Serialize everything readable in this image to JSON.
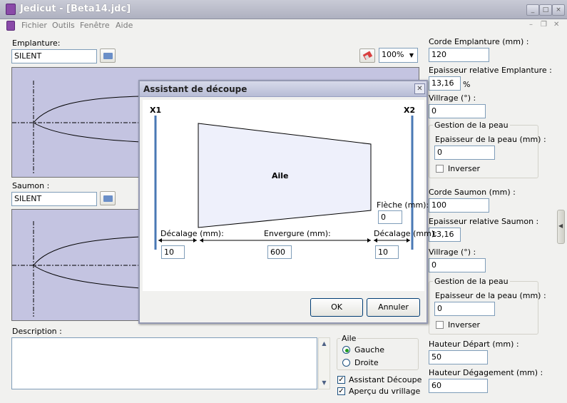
{
  "window": {
    "title": "Jedicut - [Beta14.jdc]"
  },
  "menu": {
    "items": [
      "Fichier",
      "Outils",
      "Fenêtre",
      "Aide"
    ]
  },
  "emplanture": {
    "label": "Emplanture:",
    "profile": "SILENT"
  },
  "zoom": {
    "value": "100%"
  },
  "saumon": {
    "label": "Saumon :",
    "profile": "SILENT"
  },
  "description": {
    "label": "Description :",
    "value": ""
  },
  "aile": {
    "label": "Aile",
    "options": [
      "Gauche",
      "Droite"
    ],
    "selected": "Gauche"
  },
  "checks": {
    "assistant": {
      "label": "Assistant Découpe",
      "checked": true
    },
    "apercu": {
      "label": "Aperçu du vrillage",
      "checked": true
    }
  },
  "right": {
    "corde_emp_label": "Corde Emplanture (mm) :",
    "corde_emp": "120",
    "epais_emp_label": "Epaisseur relative Emplanture :",
    "epais_emp": "13,16",
    "percent": "%",
    "vrillage1_label": "Villrage (°) :",
    "vrillage1": "0",
    "peau1_title": "Gestion de la peau",
    "peau1_label": "Epaisseur de la peau (mm) :",
    "peau1": "0",
    "inverser1": "Inverser",
    "corde_sau_label": "Corde Saumon (mm) :",
    "corde_sau": "100",
    "epais_sau_label": "Epaisseur relative Saumon :",
    "epais_sau": "13,16",
    "vrillage2_label": "Villrage (°) :",
    "vrillage2": "0",
    "peau2_title": "Gestion de la peau",
    "peau2_label": "Epaisseur de la peau (mm) :",
    "peau2": "0",
    "inverser2": "Inverser",
    "h_depart_label": "Hauteur Départ (mm) :",
    "h_depart": "50",
    "h_degag_label": "Hauteur Dégagement (mm) :",
    "h_degag": "60"
  },
  "dialog": {
    "title": "Assistant de découpe",
    "x1": "X1",
    "x2": "X2",
    "aile": "Aile",
    "fleche_label": "Flèche (mm):",
    "fleche": "0",
    "decalage1_label": "Décalage (mm):",
    "decalage1": "10",
    "envergure_label": "Envergure (mm):",
    "envergure": "600",
    "decalage2_label": "Décalage (mm):",
    "decalage2": "10",
    "ok": "OK",
    "cancel": "Annuler"
  },
  "colors": {
    "preview_bg": "#c4c4e1",
    "accent": "#4a78b5",
    "title_bar": "#b8bdd6"
  }
}
